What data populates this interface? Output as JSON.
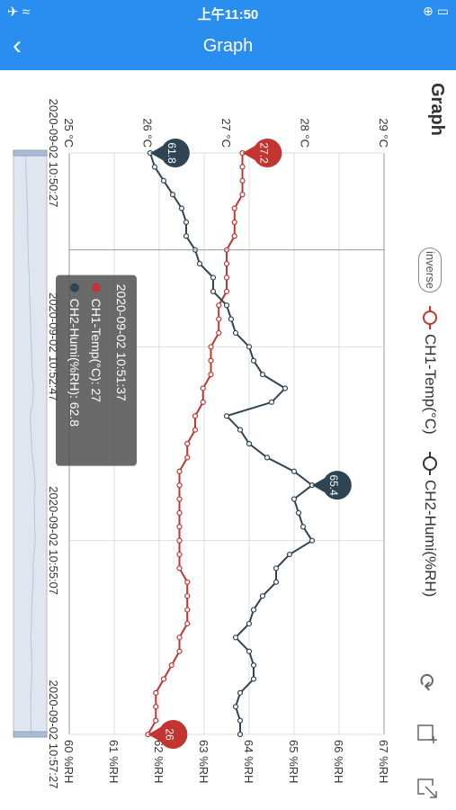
{
  "status_bar": {
    "time": "上午11:50",
    "left_icons": "✈ ≈",
    "right_icons": "⊕ ▭"
  },
  "nav": {
    "title": "Graph",
    "back_icon": "back-chevron-icon"
  },
  "graph": {
    "title": "Graph",
    "inverse_label": "inverse",
    "legend": [
      {
        "label": "CH1-Temp(°C)",
        "color": "#c23531"
      },
      {
        "label": "CH2-Humi(%RH)",
        "color": "#2f4554"
      }
    ],
    "toolbar_icons": [
      "refresh-icon",
      "zoom-icon",
      "export-icon"
    ]
  },
  "tooltip": {
    "time": "2020-09-02 10:51:37",
    "rows": [
      "CH1-Temp(°C): 27",
      "CH2-Humi(%RH): 62.8"
    ]
  },
  "markers": {
    "temp_max": "27.2",
    "temp_min": "26",
    "humi_min": "61.8",
    "humi_max": "65.4"
  },
  "chart_data": {
    "type": "line",
    "x": [
      "2020-09-02 10:50:27",
      "10:50:37",
      "10:50:47",
      "10:50:57",
      "10:51:07",
      "10:51:17",
      "10:51:27",
      "10:51:37",
      "10:51:47",
      "10:51:57",
      "10:52:07",
      "10:52:17",
      "10:52:27",
      "10:52:37",
      "10:52:47",
      "10:52:57",
      "10:53:07",
      "10:53:17",
      "10:53:27",
      "10:53:37",
      "10:53:47",
      "10:53:57",
      "10:54:07",
      "10:54:17",
      "10:54:27",
      "10:54:37",
      "10:54:47",
      "10:54:57",
      "10:55:07",
      "10:55:17",
      "10:55:27",
      "10:55:37",
      "10:55:47",
      "10:55:57",
      "10:56:07",
      "10:56:17",
      "10:56:27",
      "10:56:37",
      "10:56:47",
      "10:56:57",
      "10:57:07",
      "10:57:17",
      "10:57:27"
    ],
    "x_tick_labels": [
      "2020-09-02 10:50:27",
      "2020-09-02 10:52:47",
      "2020-09-02 10:55:07",
      "2020-09-02 10:57:27"
    ],
    "series": [
      {
        "name": "CH1-Temp(°C)",
        "axis": "left",
        "color": "#c23531",
        "values": [
          27.2,
          27.2,
          27.2,
          27.2,
          27.1,
          27.1,
          27.1,
          27.0,
          27.0,
          27.0,
          27.0,
          26.9,
          26.9,
          26.9,
          26.8,
          26.8,
          26.8,
          26.7,
          26.7,
          26.6,
          26.6,
          26.5,
          26.5,
          26.4,
          26.4,
          26.4,
          26.4,
          26.4,
          26.4,
          26.4,
          26.4,
          26.5,
          26.5,
          26.5,
          26.5,
          26.4,
          26.4,
          26.3,
          26.2,
          26.1,
          26.1,
          26.1,
          26.0
        ]
      },
      {
        "name": "CH2-Humi(%RH)",
        "axis": "right",
        "color": "#2f4554",
        "values": [
          61.8,
          61.9,
          62.1,
          62.3,
          62.5,
          62.6,
          62.6,
          62.8,
          62.9,
          63.2,
          63.2,
          63.5,
          63.6,
          63.7,
          64.0,
          64.1,
          64.3,
          64.8,
          64.5,
          63.5,
          63.8,
          64.0,
          64.4,
          65.0,
          65.4,
          65.0,
          65.1,
          65.2,
          65.4,
          64.9,
          64.6,
          64.6,
          64.3,
          64.1,
          64.0,
          63.7,
          64.0,
          64.1,
          64.1,
          63.8,
          63.7,
          63.8,
          63.8
        ]
      }
    ],
    "y_left": {
      "ticks": [
        "25 °C",
        "26 °C",
        "27 °C",
        "28 °C",
        "29 °C"
      ],
      "min": 25,
      "max": 29
    },
    "y_right": {
      "ticks": [
        "60 %RH",
        "61 %RH",
        "62 %RH",
        "63 %RH",
        "64 %RH",
        "65 %RH",
        "66 %RH",
        "67 %RH"
      ],
      "min": 60,
      "max": 67
    },
    "grid": true,
    "legend_position": "top"
  }
}
